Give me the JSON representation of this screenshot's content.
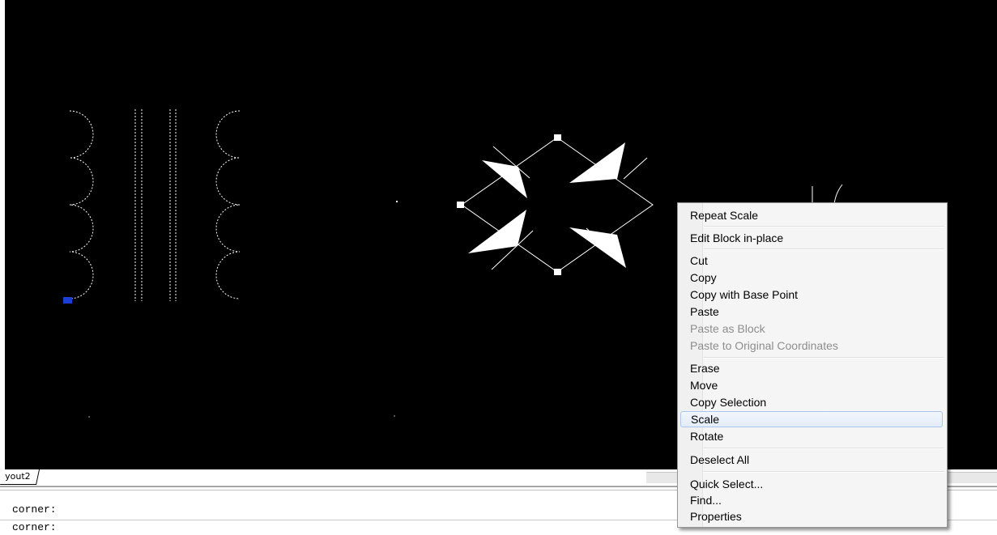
{
  "layout_tab": {
    "label": "yout2"
  },
  "command_line": {
    "lines": [
      "corner:",
      "corner:"
    ]
  },
  "context_menu": {
    "groups": [
      [
        {
          "label": "Repeat Scale",
          "enabled": true
        }
      ],
      [
        {
          "label": "Edit Block in-place",
          "enabled": true
        }
      ],
      [
        {
          "label": "Cut",
          "enabled": true
        },
        {
          "label": "Copy",
          "enabled": true
        },
        {
          "label": "Copy with Base Point",
          "enabled": true
        },
        {
          "label": "Paste",
          "enabled": true
        },
        {
          "label": "Paste as Block",
          "enabled": false
        },
        {
          "label": "Paste to Original Coordinates",
          "enabled": false
        }
      ],
      [
        {
          "label": "Erase",
          "enabled": true
        },
        {
          "label": "Move",
          "enabled": true
        },
        {
          "label": "Copy Selection",
          "enabled": true
        },
        {
          "label": "Scale",
          "enabled": true,
          "highlighted": true
        },
        {
          "label": "Rotate",
          "enabled": true
        }
      ],
      [
        {
          "label": "Deselect All",
          "enabled": true
        }
      ],
      [
        {
          "label": "Quick Select...",
          "enabled": true
        },
        {
          "label": "Find...",
          "enabled": true
        },
        {
          "label": "Properties",
          "enabled": true
        }
      ]
    ]
  },
  "colors": {
    "canvas_background": "#000000",
    "drawing_lines": "#ffffff",
    "grip_selected": "#1a3fd6",
    "grip_unselected": "#ffffff",
    "menu_highlight_border": "#a8c6ee"
  }
}
